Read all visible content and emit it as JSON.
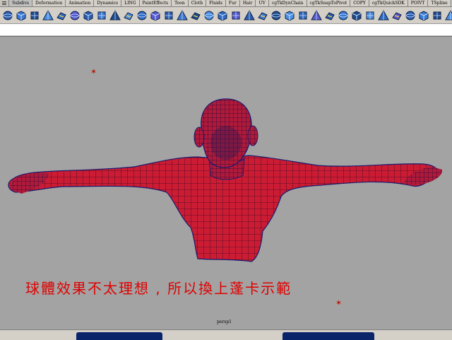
{
  "shelf_tabs": [
    "Subdivs",
    "Deformation",
    "Animation",
    "Dynamics",
    "LING",
    "PaintEffects",
    "Toon",
    "Cloth",
    "Fluids",
    "Fur",
    "Hair",
    "UV",
    "cgTkDynChain",
    "cgTkSnapToPivot",
    "COPY",
    "cgTkQuickSDK",
    "POIVT",
    "TSpline"
  ],
  "shelf_icons": [
    "sphere",
    "cube",
    "cylinder",
    "cone",
    "plane",
    "torus",
    "poly-sphere",
    "poly-cube",
    "poly-cylinder",
    "poly-cone",
    "poly-plane",
    "poly-torus",
    "cut-faces",
    "extrude",
    "bevel",
    "split",
    "merge",
    "wedge",
    "smooth",
    "soften",
    "hardness",
    "mirror",
    "combine",
    "separate",
    "normals",
    "uv-map",
    "planar",
    "cylindrical",
    "spherical",
    "automatic",
    "layout",
    "cut-uv",
    "sew-uv",
    "unfold",
    "relax",
    "align",
    "snap",
    "flip",
    "rotate-uv",
    "grid",
    "checker-icon"
  ],
  "viewport": {
    "caption": "球體效果不太理想 , 所以換上蓬卡示範",
    "camera_label": "persp1"
  },
  "colors": {
    "model_fill": "#cc1c34",
    "wire": "#1a1a6e",
    "caption": "#e00000",
    "background": "#a3a3a3"
  }
}
